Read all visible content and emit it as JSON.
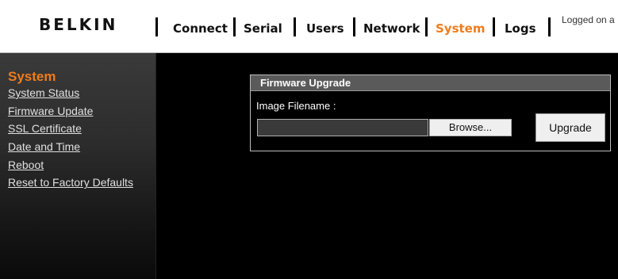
{
  "header": {
    "logo": "BELKIN",
    "nav": [
      {
        "label": "Connect",
        "active": false
      },
      {
        "label": "Serial",
        "active": false
      },
      {
        "label": "Users",
        "active": false
      },
      {
        "label": "Network",
        "active": false
      },
      {
        "label": "System",
        "active": true
      },
      {
        "label": "Logs",
        "active": false
      }
    ],
    "logged_text": "Logged on a"
  },
  "sidebar": {
    "title": "System",
    "items": [
      {
        "label": "System Status"
      },
      {
        "label": "Firmware Update"
      },
      {
        "label": "SSL Certificate"
      },
      {
        "label": "Date and Time"
      },
      {
        "label": "Reboot"
      },
      {
        "label": "Reset to Factory Defaults"
      }
    ]
  },
  "panel": {
    "title": "Firmware Upgrade",
    "field_label": "Image Filename :",
    "file_value": "",
    "browse_label": "Browse...",
    "upgrade_label": "Upgrade"
  },
  "colors": {
    "accent": "#f07c1b",
    "background": "#000000",
    "header_bg": "#ffffff",
    "panel_title_bg": "#5a5a5a"
  }
}
